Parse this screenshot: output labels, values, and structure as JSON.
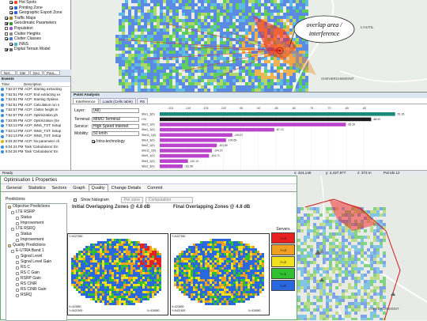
{
  "layer_tree": {
    "items": [
      {
        "label": "Hot Spots",
        "checked": true,
        "icon": "#e84a2a",
        "indent": 12
      },
      {
        "label": "Printing Zone",
        "checked": true,
        "icon": "#2a6ad8",
        "indent": 12
      },
      {
        "label": "Geographic Export Zone",
        "checked": true,
        "icon": "#2a6ad8",
        "indent": 12
      },
      {
        "label": "Traffic Maps",
        "checked": true,
        "icon": "#a08030",
        "indent": 6
      },
      {
        "label": "Geoclimatic Parameters",
        "checked": true,
        "icon": "#3a9a3a",
        "indent": 6
      },
      {
        "label": "Population",
        "checked": false,
        "icon": "#9a5ac8",
        "indent": 6
      },
      {
        "label": "Clutter Heights",
        "checked": false,
        "icon": "#8a8a8a",
        "indent": 6
      },
      {
        "label": "Clutter Classes",
        "checked": true,
        "icon": "#4a7ad8",
        "indent": 6
      },
      {
        "label": "INNS",
        "checked": true,
        "icon": "#4ab0d8",
        "indent": 12
      },
      {
        "label": "Digital Terrain Model",
        "checked": true,
        "icon": "#6a6a6a",
        "indent": 6
      }
    ]
  },
  "dock_tabs": [
    "Net...",
    "Site",
    "Geo",
    "Para..."
  ],
  "events": {
    "title": "Events",
    "col_time": "Time",
    "col_desc": "Description",
    "rows": [
      {
        "time": "7:52:27 PM",
        "desc": "ACP: Starting extracting",
        "warn": false
      },
      {
        "time": "7:52:51 PM",
        "desc": "ACP: End extracting ex",
        "warn": false
      },
      {
        "time": "7:52:51 PM",
        "desc": "ACP: Starting Optimis",
        "warn": false
      },
      {
        "time": "7:52:51 PM",
        "desc": "ACP: Calculation run s",
        "warn": false
      },
      {
        "time": "7:52:57 PM",
        "desc": "ACP: Clutter height m",
        "warn": false
      },
      {
        "time": "7:52:57 PM",
        "desc": "ACP: Optimization ph",
        "warn": false
      },
      {
        "time": "7:53:05 PM",
        "desc": "ACP: Optimization (Se",
        "warn": false
      },
      {
        "time": "7:53:13 PM",
        "desc": "ACP: INNS_TST: Setup",
        "warn": false
      },
      {
        "time": "7:53:13 PM",
        "desc": "ACP: INNS_TST: Setup",
        "warn": false
      },
      {
        "time": "7:53:13 PM",
        "desc": "ACP: INNS_TST: Setup",
        "warn": false
      },
      {
        "time": "8:04:20 PM",
        "desc": "ACP: No parameter ch",
        "warn": true
      },
      {
        "time": "8:04:24 PM",
        "desc": "Task 'Calculations' En",
        "warn": false
      },
      {
        "time": "8:04:25 PM",
        "desc": "Task 'Calculations' En",
        "warn": false
      }
    ]
  },
  "map": {
    "callout_line1": "overlap area /",
    "callout_line2": "interference",
    "place1": "L'HUTIL",
    "place2": "CHEVERCHEMONT",
    "place3": "CHEVERCHEMONT"
  },
  "analysis": {
    "title": "Point Analysis",
    "tabs": [
      "Interference",
      "Loads (Cells table)",
      "RS"
    ],
    "layer_label": "Layer:",
    "layer_value": "(All)",
    "terminal_label": "Terminal:",
    "terminal_value": "MIMO Terminal",
    "service_label": "Service:",
    "service_value": "High Speed Internet",
    "mobility_label": "Mobility:",
    "mobility_value": "50 km/h",
    "intra_label": "Intra-technology",
    "col_header": "dBm",
    "ticks": [
      "-115",
      "-110",
      "-105",
      "-100",
      "-95",
      "-90",
      "-85",
      "-80",
      "-75",
      "-70",
      "-65",
      "-60"
    ],
    "bars": [
      {
        "label": "Site1_3(0)",
        "value": -51.2,
        "color": "#1a8a7a",
        "text": "-51.26"
      },
      {
        "label": "I+N",
        "value": -58.0,
        "color": "#1a1a1a",
        "text": "-68.00"
      },
      {
        "label": "Site7_1(0)",
        "value": -65.2,
        "color": "#bb44cc",
        "text": "-65.18"
      },
      {
        "label": "Site1_1(0)",
        "value": -85.5,
        "color": "#bb44cc",
        "text": "-87.13"
      },
      {
        "label": "Site11_1(0)",
        "value": -97.4,
        "color": "#bb44cc",
        "text": "-100.27"
      },
      {
        "label": "Site4_3(0)",
        "value": -99.2,
        "color": "#bb44cc",
        "text": "-100.69"
      },
      {
        "label": "Site2_1(0)",
        "value": -101.8,
        "color": "#bb44cc",
        "text": "-101.80"
      },
      {
        "label": "Site11_2(0)",
        "value": -103.2,
        "color": "#bb44cc",
        "text": "-104.20"
      },
      {
        "label": "Site9_1(0)",
        "value": -104.0,
        "color": "#bb44cc",
        "text": "-104.71"
      },
      {
        "label": "Site3_2(0)",
        "value": -110.0,
        "color": "#bb44cc",
        "text": "-110.13"
      },
      {
        "label": "Site2_3(0)",
        "value": -111.5,
        "color": "#bb44cc",
        "text": "-111.58"
      }
    ]
  },
  "status_bar": {
    "left": "Ready",
    "x": "x: 424,140",
    "y": "y: 2,427,977",
    "z": "z: 373 m",
    "lat": "Pal Ids 12"
  },
  "dialog": {
    "title": "Optimisation 1 Properties",
    "tabs": [
      "General",
      "Statistics",
      "Sectors",
      "Graph",
      "Quality",
      "Change Details",
      "Commit"
    ],
    "active_tab": "Quality",
    "predictions_label": "Predictions",
    "show_histogram": "Show histogram",
    "per_zone": "Per zone",
    "computation": "Computation",
    "initial_title": "Initial Overlapping Zones @ 4.8 dB",
    "final_title": "Final Overlapping Zones @ 4.8 dB",
    "legend_title": "Servers",
    "legend": [
      {
        "label": ">=4",
        "color": "#e82020"
      },
      {
        "label": ">=3",
        "color": "#f0a020"
      },
      {
        "label": ">=2",
        "color": "#f0e020"
      },
      {
        "label": ">=1",
        "color": "#30c030"
      },
      {
        "label": ">=0",
        "color": "#2a68e0"
      }
    ],
    "coord_tl": "Y=5427650",
    "coord_bl": "X=423850",
    "coord_bl2": "Y=5421500",
    "coord_br": "X=426550",
    "coord_tl_b": "Y=5427650",
    "coord_bl_b": "X=423850",
    "coord_bl2_b": "Y=5421500",
    "coord_br_b": "X=426550",
    "tree": [
      {
        "label": "Objective Predictions",
        "indent": 0,
        "icon": "#f0c040"
      },
      {
        "label": "LTE RSRP",
        "indent": 4,
        "icon": "#ffffff"
      },
      {
        "label": "Status",
        "indent": 10,
        "icon": "#ffffff"
      },
      {
        "label": "Improvement",
        "indent": 10,
        "icon": "#ffffff"
      },
      {
        "label": "LTE RSRQ",
        "indent": 4,
        "icon": "#ffffff"
      },
      {
        "label": "Status",
        "indent": 10,
        "icon": "#ffffff"
      },
      {
        "label": "Improvement",
        "indent": 10,
        "icon": "#ffffff"
      },
      {
        "label": "Quality Predictions",
        "indent": 0,
        "icon": "#f0c040"
      },
      {
        "label": "E-UTRA Band 1",
        "indent": 4,
        "icon": "#ffffff"
      },
      {
        "label": "Signal Level",
        "indent": 10,
        "icon": "#ffffff"
      },
      {
        "label": "Signal Level Gain",
        "indent": 10,
        "icon": "#ffffff"
      },
      {
        "label": "RS C",
        "indent": 10,
        "icon": "#ffffff"
      },
      {
        "label": "RS C Gain",
        "indent": 10,
        "icon": "#ffffff"
      },
      {
        "label": "RSRP Gain",
        "indent": 10,
        "icon": "#ffffff"
      },
      {
        "label": "RS CINR",
        "indent": 10,
        "icon": "#ffffff"
      },
      {
        "label": "RS CINR Gain",
        "indent": 10,
        "icon": "#ffffff"
      },
      {
        "label": "RSRQ",
        "indent": 10,
        "icon": "#ffffff"
      }
    ]
  }
}
